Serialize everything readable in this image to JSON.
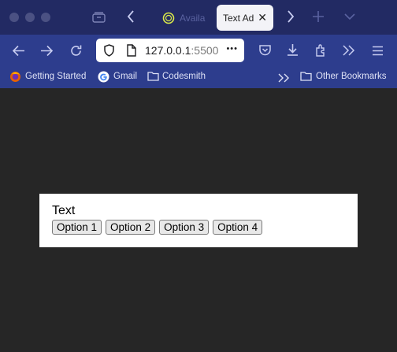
{
  "window": {
    "tabs": [
      {
        "label": "Availa",
        "active": false
      },
      {
        "label": "Text Ad",
        "active": true
      }
    ],
    "close_glyph": "✕"
  },
  "toolbar": {
    "url_host": "127.0.0.1",
    "url_port": ":5500",
    "more_glyph": "•••"
  },
  "bookmarks": [
    {
      "label": "Getting Started",
      "icon": "firefox-icon"
    },
    {
      "label": "Gmail",
      "icon": "google-icon"
    },
    {
      "label": "Codesmith",
      "icon": "folder-icon"
    }
  ],
  "other_bookmarks": {
    "label": "Other Bookmarks",
    "icon": "folder-icon"
  },
  "page": {
    "text": "Text",
    "options": [
      "Option 1",
      "Option 2",
      "Option 3",
      "Option 4"
    ]
  },
  "colors": {
    "titlebar": "#222a63",
    "toolbar": "#2d3d8d",
    "page_background": "#262626",
    "card": "#ffffff"
  }
}
